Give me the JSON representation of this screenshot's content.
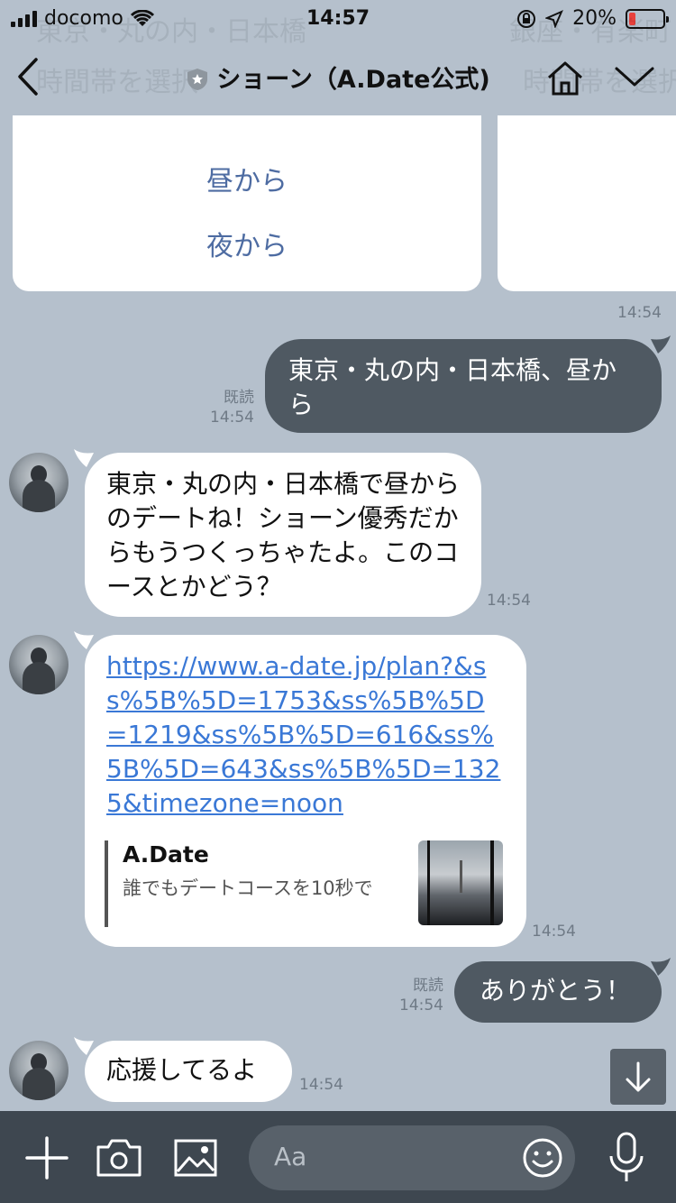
{
  "status": {
    "carrier": "docomo",
    "time": "14:57",
    "battery": "20%",
    "battery_level": 0.2
  },
  "header": {
    "title": "ショーン（A.Date公式)",
    "ghost_left": "東京・丸の内・日本橋",
    "ghost_left2": "時間帯を選択",
    "ghost_right": "銀座・有楽町",
    "ghost_right2": "時間帯を選択"
  },
  "card": {
    "options": [
      "昼から",
      "夜から"
    ],
    "time": "14:54"
  },
  "messages": {
    "m1": {
      "text": "東京・丸の内・日本橋、昼から",
      "read": "既読",
      "time": "14:54"
    },
    "m2": {
      "text": "東京・丸の内・日本橋で昼からのデートね！ショーン優秀だからもうつくっちゃたよ。このコースとかどう？",
      "time": "14:54"
    },
    "m3": {
      "link": "https://www.a-date.jp/plan?&ss%5B%5D=1753&ss%5B%5D=1219&ss%5B%5D=616&ss%5B%5D=643&ss%5B%5D=1325&timezone=noon",
      "preview_title": "A.Date",
      "preview_desc": "誰でもデートコースを10秒で",
      "time": "14:54"
    },
    "m4": {
      "text": "ありがとう！",
      "read": "既読",
      "time": "14:54"
    },
    "m5": {
      "text": "応援してるよ",
      "time": "14:54"
    }
  },
  "composer": {
    "placeholder": "Aa"
  }
}
